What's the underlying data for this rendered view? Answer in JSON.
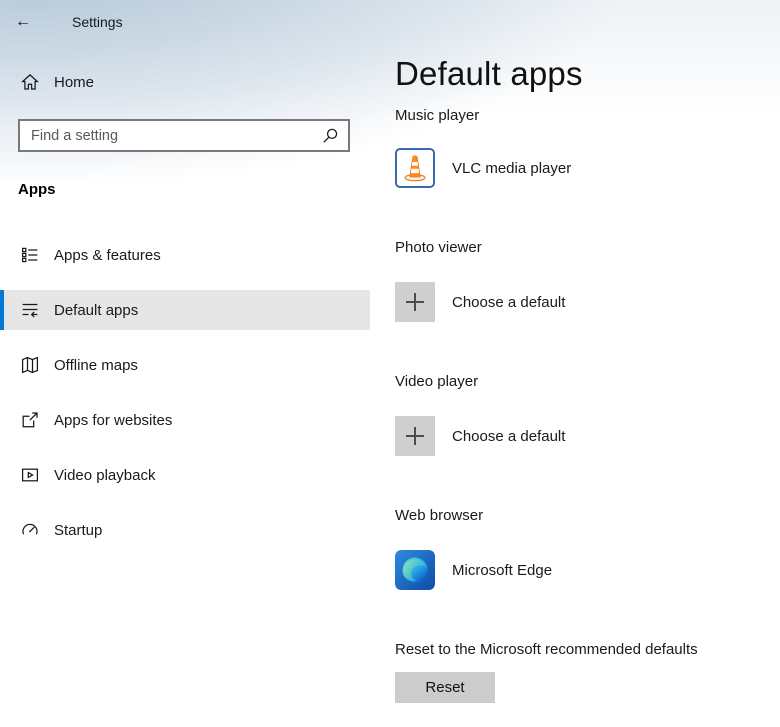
{
  "titlebar": {
    "title": "Settings",
    "back_glyph": "←"
  },
  "sidebar": {
    "home_label": "Home",
    "search_placeholder": "Find a setting",
    "section_header": "Apps",
    "items": [
      {
        "label": "Apps & features",
        "icon": "apps-features-icon",
        "selected": false
      },
      {
        "label": "Default apps",
        "icon": "default-apps-icon",
        "selected": true
      },
      {
        "label": "Offline maps",
        "icon": "offline-maps-icon",
        "selected": false
      },
      {
        "label": "Apps for websites",
        "icon": "apps-for-websites-icon",
        "selected": false
      },
      {
        "label": "Video playback",
        "icon": "video-playback-icon",
        "selected": false
      },
      {
        "label": "Startup",
        "icon": "startup-icon",
        "selected": false
      }
    ]
  },
  "main": {
    "title": "Default apps",
    "sections": [
      {
        "category": "Music player",
        "app_name": "VLC media player",
        "icon": "vlc-icon"
      },
      {
        "category": "Photo viewer",
        "app_name": "Choose a default",
        "icon": "plus-icon"
      },
      {
        "category": "Video player",
        "app_name": "Choose a default",
        "icon": "plus-icon"
      },
      {
        "category": "Web browser",
        "app_name": "Microsoft Edge",
        "icon": "edge-icon"
      }
    ],
    "reset_label": "Reset to the Microsoft recommended defaults",
    "reset_button_label": "Reset"
  },
  "colors": {
    "accent": "#0078d7",
    "selected_item_bg": "#e6e6e6",
    "tile_gray": "#cfcfcf",
    "reset_button_bg": "#cccccc"
  }
}
